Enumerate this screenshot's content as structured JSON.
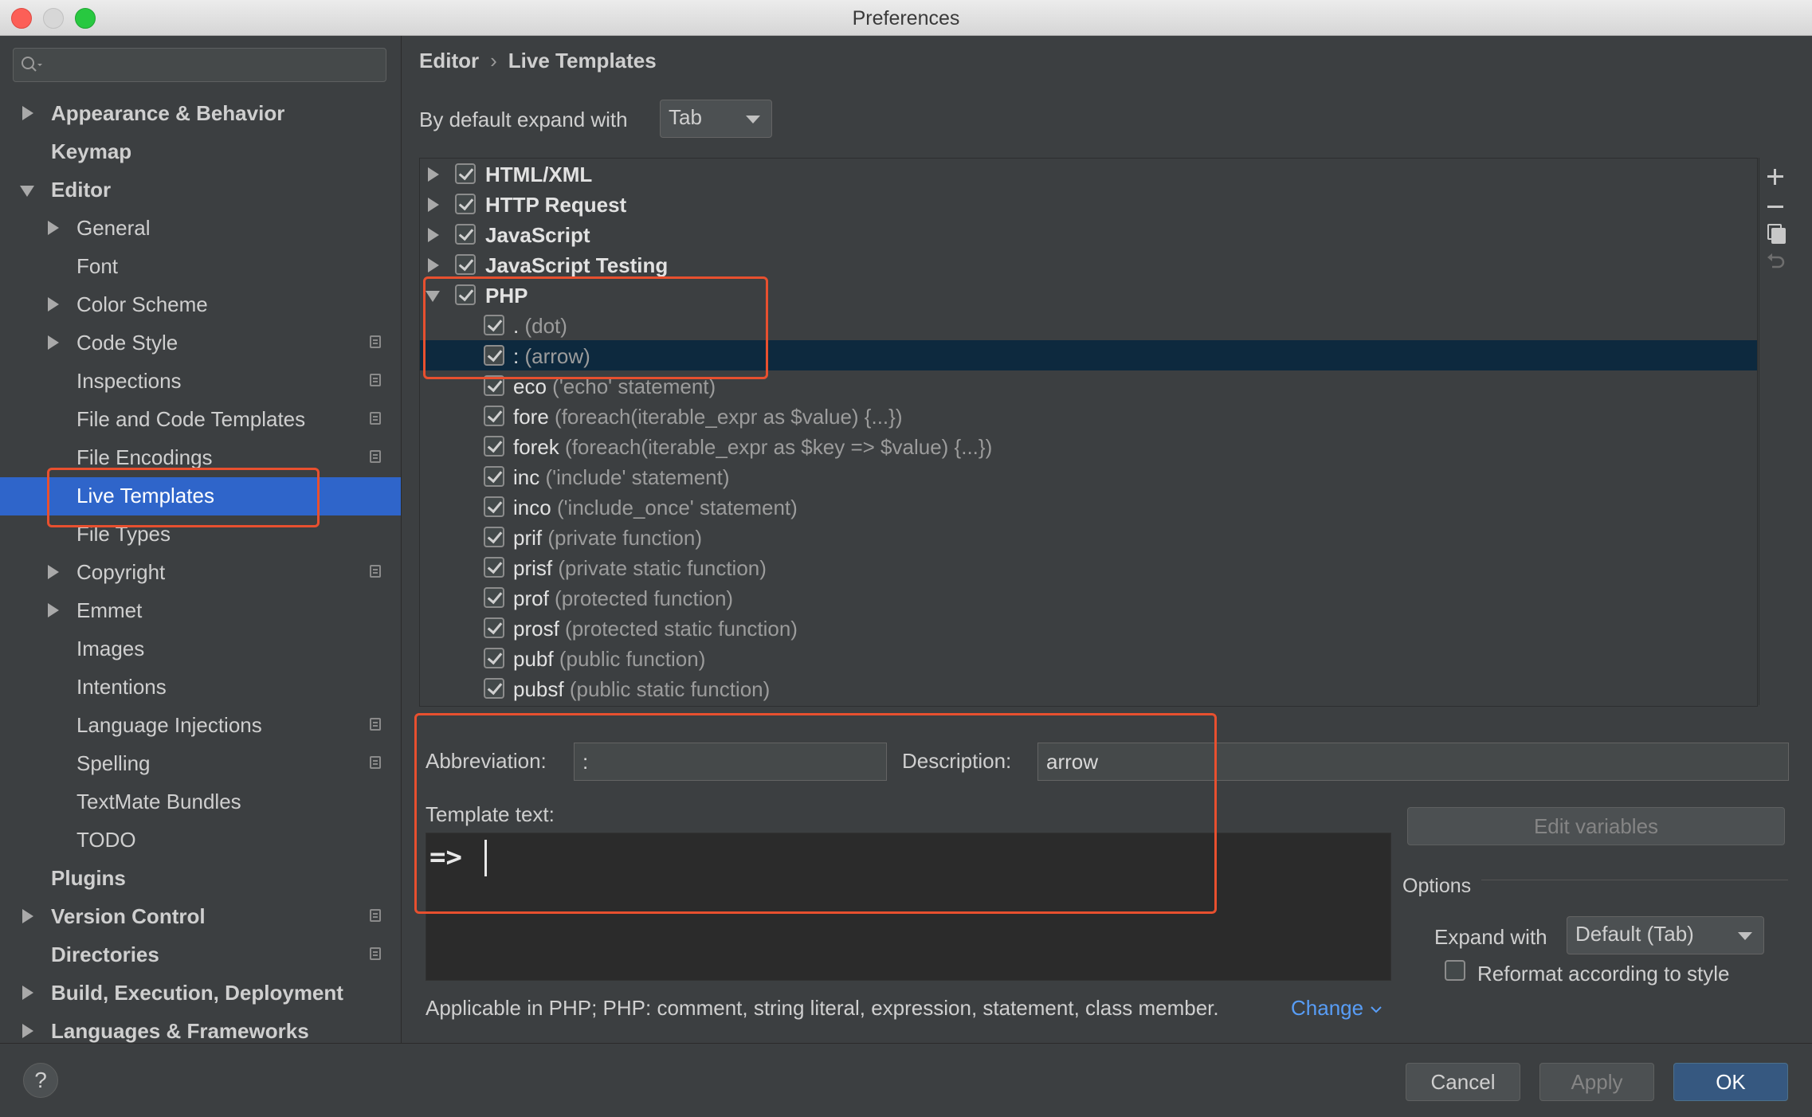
{
  "window": {
    "title": "Preferences"
  },
  "sidebar": {
    "items": [
      {
        "label": "Appearance & Behavior",
        "bold": true,
        "level": 0,
        "arrow": "right"
      },
      {
        "label": "Keymap",
        "bold": true,
        "level": 0,
        "arrow": ""
      },
      {
        "label": "Editor",
        "bold": true,
        "level": 0,
        "arrow": "down"
      },
      {
        "label": "General",
        "level": 1,
        "arrow": "right"
      },
      {
        "label": "Font",
        "level": 1,
        "arrow": ""
      },
      {
        "label": "Color Scheme",
        "level": 1,
        "arrow": "right"
      },
      {
        "label": "Code Style",
        "level": 1,
        "arrow": "right",
        "cfg": true
      },
      {
        "label": "Inspections",
        "level": 1,
        "arrow": "",
        "cfg": true
      },
      {
        "label": "File and Code Templates",
        "level": 1,
        "arrow": "",
        "cfg": true
      },
      {
        "label": "File Encodings",
        "level": 1,
        "arrow": "",
        "cfg": true
      },
      {
        "label": "Live Templates",
        "level": 1,
        "arrow": "",
        "selected": true
      },
      {
        "label": "File Types",
        "level": 1,
        "arrow": ""
      },
      {
        "label": "Copyright",
        "level": 1,
        "arrow": "right",
        "cfg": true
      },
      {
        "label": "Emmet",
        "level": 1,
        "arrow": "right"
      },
      {
        "label": "Images",
        "level": 1,
        "arrow": ""
      },
      {
        "label": "Intentions",
        "level": 1,
        "arrow": ""
      },
      {
        "label": "Language Injections",
        "level": 1,
        "arrow": "",
        "cfg": true
      },
      {
        "label": "Spelling",
        "level": 1,
        "arrow": "",
        "cfg": true
      },
      {
        "label": "TextMate Bundles",
        "level": 1,
        "arrow": ""
      },
      {
        "label": "TODO",
        "level": 1,
        "arrow": ""
      },
      {
        "label": "Plugins",
        "bold": true,
        "level": 0,
        "arrow": ""
      },
      {
        "label": "Version Control",
        "bold": true,
        "level": 0,
        "arrow": "right",
        "cfg": true
      },
      {
        "label": "Directories",
        "bold": true,
        "level": 0,
        "arrow": "",
        "cfg": true
      },
      {
        "label": "Build, Execution, Deployment",
        "bold": true,
        "level": 0,
        "arrow": "right"
      },
      {
        "label": "Languages & Frameworks",
        "bold": true,
        "level": 0,
        "arrow": "right"
      }
    ]
  },
  "breadcrumb": {
    "parent": "Editor",
    "separator": "›",
    "current": "Live Templates"
  },
  "expand": {
    "label": "By default expand with",
    "value": "Tab"
  },
  "templates": {
    "groups": [
      {
        "name": "HTML/XML",
        "expanded": false
      },
      {
        "name": "HTTP Request",
        "expanded": false
      },
      {
        "name": "JavaScript",
        "expanded": false
      },
      {
        "name": "JavaScript Testing",
        "expanded": false
      },
      {
        "name": "PHP",
        "expanded": true
      }
    ],
    "php_items": [
      {
        "abbr": ".",
        "desc": "(dot)"
      },
      {
        "abbr": ":",
        "desc": "(arrow)",
        "selected": true
      },
      {
        "abbr": "eco",
        "desc": "('echo' statement)"
      },
      {
        "abbr": "fore",
        "desc": "(foreach(iterable_expr as $value) {...})"
      },
      {
        "abbr": "forek",
        "desc": "(foreach(iterable_expr as $key => $value) {...})"
      },
      {
        "abbr": "inc",
        "desc": "('include' statement)"
      },
      {
        "abbr": "inco",
        "desc": "('include_once' statement)"
      },
      {
        "abbr": "prif",
        "desc": "(private function)"
      },
      {
        "abbr": "prisf",
        "desc": "(private static function)"
      },
      {
        "abbr": "prof",
        "desc": "(protected function)"
      },
      {
        "abbr": "prosf",
        "desc": "(protected static function)"
      },
      {
        "abbr": "pubf",
        "desc": "(public function)"
      },
      {
        "abbr": "pubsf",
        "desc": "(public static function)"
      }
    ]
  },
  "tools": [
    "add-icon",
    "remove-icon",
    "copy-icon",
    "revert-icon"
  ],
  "editor": {
    "abbreviation_label": "Abbreviation:",
    "abbreviation_value": ":",
    "description_label": "Description:",
    "description_value": "arrow",
    "template_text_label": "Template text:",
    "template_text": "=>",
    "edit_variables": "Edit variables",
    "options_label": "Options",
    "expand_with_label": "Expand with",
    "expand_with_value": "Default (Tab)",
    "reformat_label": "Reformat according to style",
    "reformat_checked": false,
    "applicable": "Applicable in PHP; PHP: comment, string literal, expression, statement, class member.",
    "change": "Change"
  },
  "footer": {
    "help": "?",
    "cancel": "Cancel",
    "apply": "Apply",
    "ok": "OK"
  },
  "colors": {
    "accent": "#2f65ca",
    "selection_row": "#0d293e",
    "highlight": "#e8502f",
    "ok_button": "#365880",
    "link": "#589df6"
  }
}
